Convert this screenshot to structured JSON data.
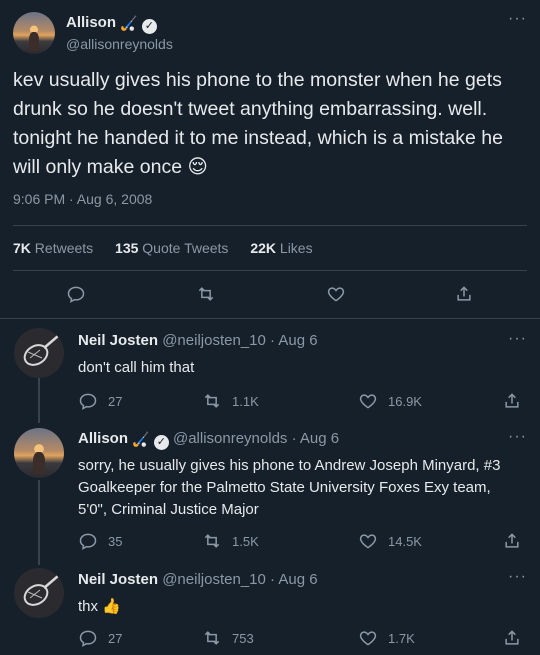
{
  "main_tweet": {
    "author_name": "Allison",
    "name_emoji": "🏑",
    "handle": "@allisonreynolds",
    "text": "kev usually gives his phone to the monster when he gets drunk so he doesn't tweet anything embarrassing. well. tonight he handed it to me instead, which is a mistake he will only make once 😌",
    "timestamp": "9:06 PM · Aug 6, 2008",
    "stats": {
      "retweets_count": "7K",
      "retweets_label": "Retweets",
      "quotes_count": "135",
      "quotes_label": "Quote Tweets",
      "likes_count": "22K",
      "likes_label": "Likes"
    },
    "more_icon": "more-icon"
  },
  "replies": [
    {
      "author_name": "Neil Josten",
      "handle": "@neiljosten_10",
      "date": "· Aug 6",
      "text": "don't call him that",
      "reply_count": "27",
      "retweet_count": "1.1K",
      "like_count": "16.9K"
    },
    {
      "author_name": "Allison",
      "name_emoji": "🏑",
      "handle": "@allisonreynolds",
      "date": "· Aug 6",
      "text": "sorry, he usually gives his phone to Andrew Joseph Minyard, #3 Goalkeeper for the Palmetto State University Foxes Exy team, 5'0\", Criminal Justice Major",
      "reply_count": "35",
      "retweet_count": "1.5K",
      "like_count": "14.5K"
    },
    {
      "author_name": "Neil Josten",
      "handle": "@neiljosten_10",
      "date": "· Aug 6",
      "text": "thx 👍",
      "reply_count": "27",
      "retweet_count": "753",
      "like_count": "1.7K"
    }
  ],
  "colors": {
    "background": "#15202b",
    "text": "#e7e9ea",
    "muted": "#8b98a5",
    "divider": "#38444d"
  }
}
